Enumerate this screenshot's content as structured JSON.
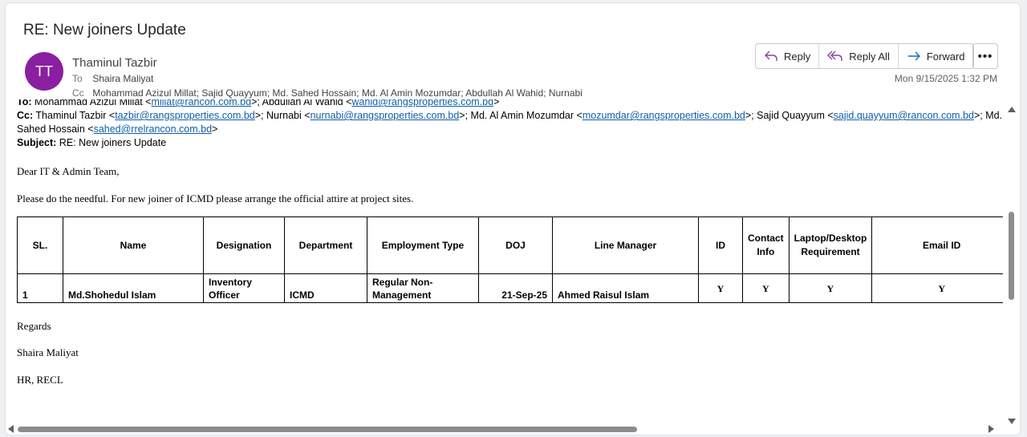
{
  "email": {
    "subject": "RE: New joiners Update",
    "avatar_initials": "TT",
    "avatar_color": "#8a1fa0",
    "sender": "Thaminul Tazbir",
    "to_label": "To",
    "to": "Shaira Maliyat",
    "cc_label": "Cc",
    "cc": "Mohammad Azizul Millat; Sajid Quayyum; Md. Sahed Hossain; Md. Al Amin Mozumdar; Abdullah Al Wahid; Nurnabi",
    "date": "Mon 9/15/2025 1:32 PM"
  },
  "actions": {
    "reply": "Reply",
    "reply_all": "Reply All",
    "forward": "Forward",
    "more": "•••"
  },
  "quoted_header": {
    "to_prefix": "To:",
    "to_text1": " Mohammad Azizul Millat <",
    "to_link1": "millat@rancon.com.bd",
    "to_text2": ">; Abdullah Al Wahid <",
    "to_link2": "wahid@rangsproperties.com.bd",
    "to_text3": ">",
    "cc_prefix": "Cc:",
    "cc_text1": " Thaminul Tazbir <",
    "cc_link1": "tazbir@rangsproperties.com.bd",
    "cc_text2": ">; Nurnabi <",
    "cc_link2": "nurnabi@rangsproperties.com.bd",
    "cc_text3": ">; Md. Al Amin Mozumdar <",
    "cc_link3": "mozumdar@rangsproperties.com.bd",
    "cc_text4": ">; Sajid Quayyum <",
    "cc_link4": "sajid.quayyum@rancon.com.bd",
    "cc_text5": ">; Md.",
    "cc_text6": "Sahed Hossain <",
    "cc_link5": "sahed@rrelrancon.com.bd",
    "cc_text7": ">",
    "subject_prefix": "Subject:",
    "subject_text": " RE: New joiners Update"
  },
  "body": {
    "greeting": "Dear IT & Admin Team,",
    "line1": "Please do the needful. For new joiner of ICMD please arrange the official attire at project sites.",
    "regards": "Regards",
    "sign_name": "Shaira Maliyat",
    "sign_dept": "HR, RECL"
  },
  "table": {
    "headers": {
      "sl": "SL.",
      "name": "Name",
      "designation": "Designation",
      "department": "Department",
      "employment_type": "Employment Type",
      "doj": "DOJ",
      "line_manager": "Line Manager",
      "id": "ID",
      "contact_a": "Contact",
      "contact_b": "Info",
      "laptop_a": "Laptop/Desktop",
      "laptop_b": "Requirement",
      "email_id": "Email ID"
    },
    "row": {
      "sl": "1",
      "name": "Md.Shohedul Islam",
      "designation_a": "Inventory",
      "designation_b": "Officer",
      "department": "ICMD",
      "employment_type_a": "Regular Non-",
      "employment_type_b": "Management",
      "doj": "21-Sep-25",
      "line_manager": "Ahmed Raisul Islam",
      "id": "Y",
      "contact": "Y",
      "laptop": "Y",
      "email_id": "Y"
    }
  }
}
